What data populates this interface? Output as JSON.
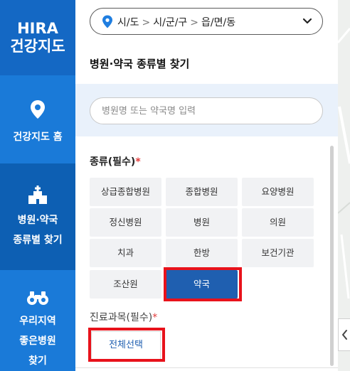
{
  "sidebar": {
    "brand_line1": "HIRA",
    "brand_line2": "건강지도",
    "items": [
      {
        "label": "건강지도 홈",
        "icon": "map-pin-icon"
      },
      {
        "label_line1": "병원·약국",
        "label_line2": "종류별 찾기",
        "icon": "hospital-icon"
      },
      {
        "label_line1": "우리지역",
        "label_line2": "좋은병원",
        "label_line3": "찾기",
        "icon": "binoculars-icon"
      }
    ]
  },
  "location": {
    "sido": "시/도",
    "sigungu": "시/군/구",
    "eupmyeondong": "읍/면/동",
    "separator": ">"
  },
  "page": {
    "title": "병원·약국 종류별 찾기"
  },
  "search": {
    "placeholder": "병원명 또는 약국명 입력",
    "value": ""
  },
  "type_section": {
    "label": "종류(필수)",
    "required_mark": "*",
    "options": [
      "상급종합병원",
      "종합병원",
      "요양병원",
      "정신병원",
      "병원",
      "의원",
      "치과",
      "한방",
      "보건기관",
      "조산원",
      "약국"
    ],
    "selected": "약국"
  },
  "dept_section": {
    "label": "진료과목(필수)",
    "required_mark": "*",
    "select_all_label": "전체선택"
  },
  "colors": {
    "sidebar": "#1a7ad8",
    "sidebar_active": "#0d5fb3",
    "accent": "#1f5fb0",
    "highlight": "#e8121b"
  }
}
